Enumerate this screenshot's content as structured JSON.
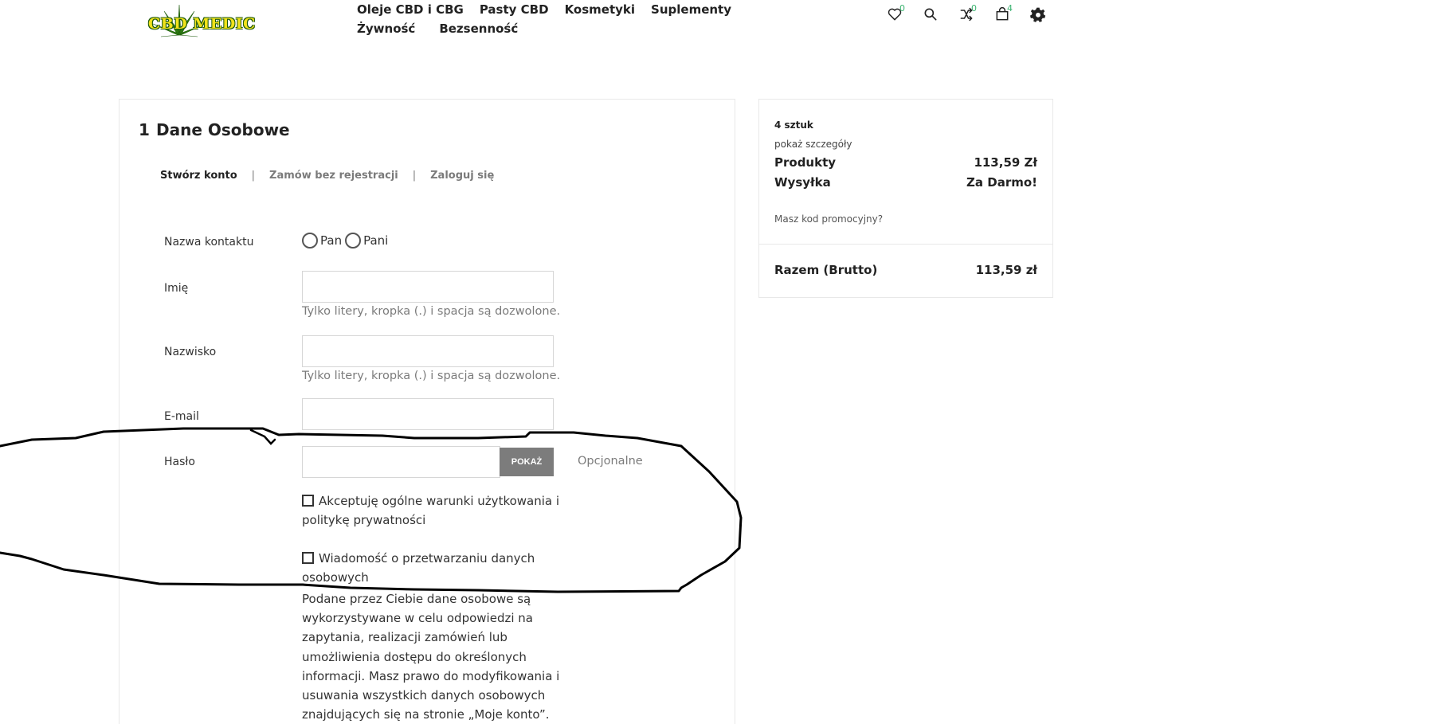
{
  "header": {
    "logo_text": "CBD MEDIC",
    "nav": [
      {
        "label": "Oleje CBD i CBG"
      },
      {
        "label": "Pasty CBD"
      },
      {
        "label": "Kosmetyki"
      },
      {
        "label": "Suplementy"
      },
      {
        "label": "Żywność"
      },
      {
        "label": "Bezsenność"
      }
    ],
    "wishlist_count": "0",
    "compare_count": "0",
    "cart_count": "4",
    "icons": [
      "heart-icon",
      "search-icon",
      "compare-icon",
      "cart-icon",
      "gear-icon"
    ]
  },
  "checkout": {
    "step_number": "1",
    "step_title": "Dane Osobowe",
    "auth_tabs": [
      "Stwórz konto",
      "Zamów bez rejestracji",
      "Zaloguj się"
    ],
    "auth_separator": "|",
    "form": {
      "contact_label": "Nazwa kontaktu",
      "gender_options": [
        "Pan",
        "Pani"
      ],
      "first_name_label": "Imię",
      "first_name_value": "",
      "first_name_help": "Tylko litery, kropka (.) i spacja są dozwolone.",
      "last_name_label": "Nazwisko",
      "last_name_value": "",
      "last_name_help": "Tylko litery, kropka (.) i spacja są dozwolone.",
      "email_label": "E-mail",
      "email_value": "",
      "password_label": "Hasło",
      "password_value": "",
      "show_button": "POKAŻ",
      "optional_text": "Opcjonalne",
      "terms_label": "Akceptuję ogólne warunki użytkowania i politykę prywatności",
      "data_processing_label": "Wiadomość o przetwarzaniu danych osobowych",
      "data_processing_desc": "Podane przez Ciebie dane osobowe są wykorzystywane w celu odpowiedzi na zapytania, realizacji zamówień lub umożliwienia dostępu do określonych informacji. Masz prawo do modyfikowania i usuwania wszystkich danych osobowych znajdujących się na stronie „Moje konto”."
    }
  },
  "summary": {
    "items_count": "4 sztuk",
    "show_details": "pokaż szczegóły",
    "products_label": "Produkty",
    "products_value": "113,59 Zł",
    "shipping_label": "Wysyłka",
    "shipping_value": "Za Darmo!",
    "promo_link": "Masz kod promocyjny?",
    "total_label": "Razem (Brutto)",
    "total_value": "113,59 zł"
  },
  "colors": {
    "accent_green": "#3cb371",
    "button_gray": "#7c7c7c",
    "border": "#e8e8e8"
  }
}
